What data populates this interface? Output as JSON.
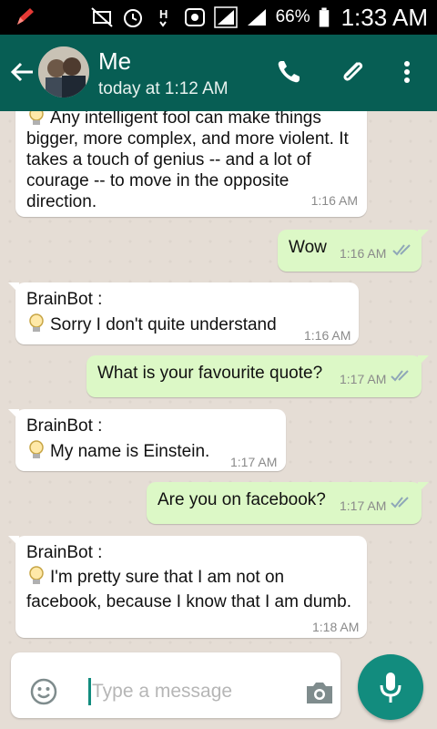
{
  "status_bar": {
    "battery_percent": "66%",
    "time": "1:33 AM",
    "icons": [
      "pencil-icon",
      "mute-icon",
      "alarm-icon",
      "h-signal-icon",
      "data-saver-icon",
      "signal-icon",
      "signal-icon",
      "battery-icon"
    ]
  },
  "chat_header": {
    "contact_name": "Me",
    "last_seen": "today at 1:12 AM",
    "icons": [
      "back-arrow-icon",
      "avatar",
      "phone-icon",
      "paperclip-icon",
      "more-icon"
    ]
  },
  "messages": [
    {
      "direction": "incoming",
      "text_line_cut": "Any intelligent fool can make things",
      "text": "bigger, more complex, and more violent. It takes a touch of genius -- and a lot of courage -- to move in the opposite direction.",
      "time": "1:16 AM"
    },
    {
      "direction": "outgoing",
      "text": "Wow",
      "time": "1:16 AM"
    },
    {
      "direction": "incoming",
      "sender": "BrainBot :",
      "text": "Sorry I don't quite understand",
      "time": "1:16 AM"
    },
    {
      "direction": "outgoing",
      "text": "What is your favourite quote?",
      "time": "1:17 AM"
    },
    {
      "direction": "incoming",
      "sender": "BrainBot :",
      "text": "My name is Einstein.",
      "time": "1:17 AM"
    },
    {
      "direction": "outgoing",
      "text": "Are you on facebook?",
      "time": "1:17 AM"
    },
    {
      "direction": "incoming",
      "sender": "BrainBot :",
      "text": "I'm pretty sure that I am not on facebook, because I know that I am dumb.",
      "time": "1:18 AM"
    }
  ],
  "composer": {
    "placeholder": "Type a message",
    "icons": [
      "emoji-icon",
      "camera-icon",
      "mic-icon"
    ]
  },
  "colors": {
    "app_bar": "#075e54",
    "outgoing_bubble": "#dcf8c6",
    "incoming_bubble": "#ffffff",
    "accent": "#128c7e",
    "read_ticks": "#8fa7b8"
  }
}
